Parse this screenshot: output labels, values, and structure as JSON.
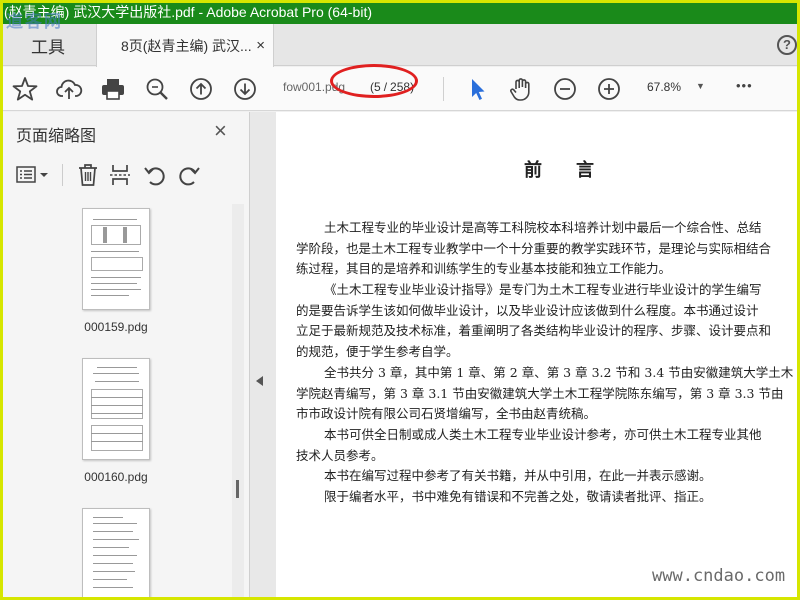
{
  "window": {
    "title": "(赵青主编) 武汉大学出版社.pdf - Adobe Acrobat Pro (64-bit)"
  },
  "tabs": {
    "tools_label": "工具",
    "doc_label": "8页(赵青主编) 武汉...",
    "close_glyph": "×",
    "help_glyph": "?"
  },
  "toolbar": {
    "filename": "fow001.pdg",
    "page_current": "5",
    "page_sep": "/",
    "page_total": "258",
    "zoom": "67.8%",
    "more_glyph": "•••",
    "icons": [
      "star-icon",
      "cloud-upload-icon",
      "print-icon",
      "search-icon",
      "page-up-icon",
      "page-down-icon",
      "select-cursor-icon",
      "hand-icon",
      "zoom-out-icon",
      "zoom-in-icon",
      "more-icon"
    ]
  },
  "sidebar": {
    "title": "页面缩略图",
    "close_glyph": "×",
    "thumbnails": [
      {
        "label": "000159.pdg"
      },
      {
        "label": "000160.pdg"
      },
      {
        "label": ""
      }
    ]
  },
  "document": {
    "heading": "前言",
    "paragraphs": [
      "土木工程专业的毕业设计是高等工科院校本科培养计划中最后一个综合性、总结",
      "学阶段，也是土木工程专业教学中一个十分重要的教学实践环节，是理论与实际相结合",
      "练过程，其目的是培养和训练学生的专业基本技能和独立工作能力。",
      "《土木工程专业毕业设计指导》是专门为土木工程专业进行毕业设计的学生编写",
      "的是要告诉学生该如何做毕业设计，以及毕业设计应该做到什么程度。本书通过设计",
      "立足于最新规范及技术标准，着重阐明了各类结构毕业设计的程序、步骤、设计要点和",
      "的规范，便于学生参考自学。",
      "全书共分 3 章，其中第 1 章、第 2 章、第 3 章 3.2 节和 3.4 节由安徽建筑大学土木",
      "学院赵青编写，第 3 章 3.1 节由安徽建筑大学土木工程学院陈东编写，第 3 章 3.3 节由",
      "市市政设计院有限公司石贤增编写，全书由赵青统稿。",
      "本书可供全日制或成人类土木工程专业毕业设计参考，亦可供土木工程专业其他",
      "技术人员参考。",
      "本书在编写过程中参考了有关书籍，并从中引用，在此一并表示感谢。",
      "限于编者水平，书中难免有错误和不完善之处，敬请读者批评、指正。"
    ],
    "indented": [
      true,
      false,
      false,
      true,
      false,
      false,
      false,
      true,
      false,
      false,
      true,
      false,
      true,
      true
    ]
  },
  "watermarks": {
    "top": "道客网",
    "bottom": "www.cndao.com"
  },
  "colors": {
    "titlebar": "#1a8a1a",
    "accent_blue": "#2a6fdb",
    "annotation_red": "#e02020",
    "frame": "#d6e600"
  }
}
